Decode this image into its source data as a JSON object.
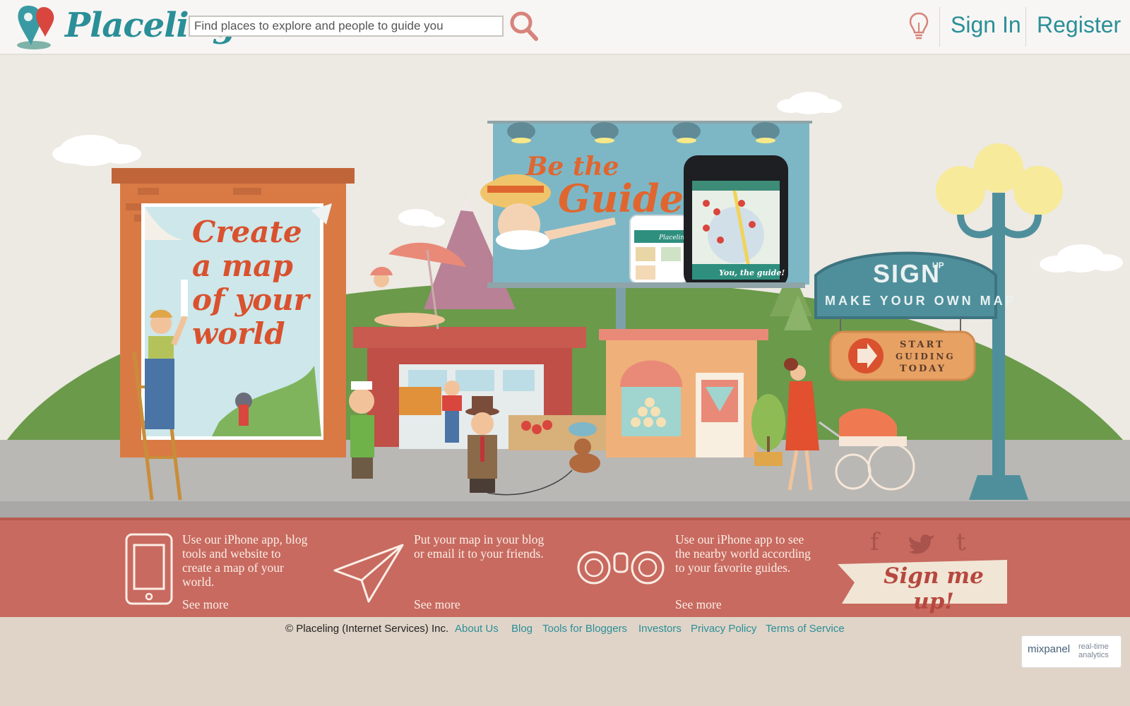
{
  "header": {
    "logo_text": "Placeling",
    "search_placeholder": "Find places to explore and people to guide you",
    "sign_in": "Sign In",
    "register": "Register"
  },
  "hero": {
    "poster_lines": [
      "Create",
      "a map",
      "of your",
      "world"
    ],
    "billboard_line1": "Be the",
    "billboard_line2": "Guide",
    "phone_caption": "You, the guide!",
    "phone_tab_label": "Placeling",
    "sign_title": "SIGN",
    "sign_up_small": "UP",
    "sign_sub": "MAKE YOUR OWN MAP",
    "hanging_sign": [
      "START",
      "GUIDING",
      "TODAY"
    ]
  },
  "features": [
    {
      "text": [
        "Use our iPhone app, blog",
        "tools and website to",
        "create a map of your",
        "world."
      ],
      "link": "See more"
    },
    {
      "text": [
        "Put your map in your blog",
        "or email it to your friends."
      ],
      "link": "See more"
    },
    {
      "text": [
        "Use our iPhone app to see",
        "the nearby world according",
        "to your favorite guides."
      ],
      "link": "See more"
    }
  ],
  "social": {
    "facebook": "f",
    "twitter": "twitter-bird",
    "tumblr": "t"
  },
  "signup_button": "Sign me up!",
  "footer": {
    "copyright": "© Placeling (Internet Services) Inc.",
    "links": [
      "About Us",
      "Blog",
      "Tools for Bloggers",
      "Investors",
      "Privacy Policy",
      "Terms of Service"
    ]
  },
  "mixpanel": {
    "name": "mixpanel",
    "sub1": "real-time",
    "sub2": "analytics"
  },
  "colors": {
    "teal": "#2a8f98",
    "coral_band": "#c86a60",
    "orange_building": "#d97a45",
    "grass": "#6a9a4a",
    "lamp_teal": "#4f8f9b"
  }
}
